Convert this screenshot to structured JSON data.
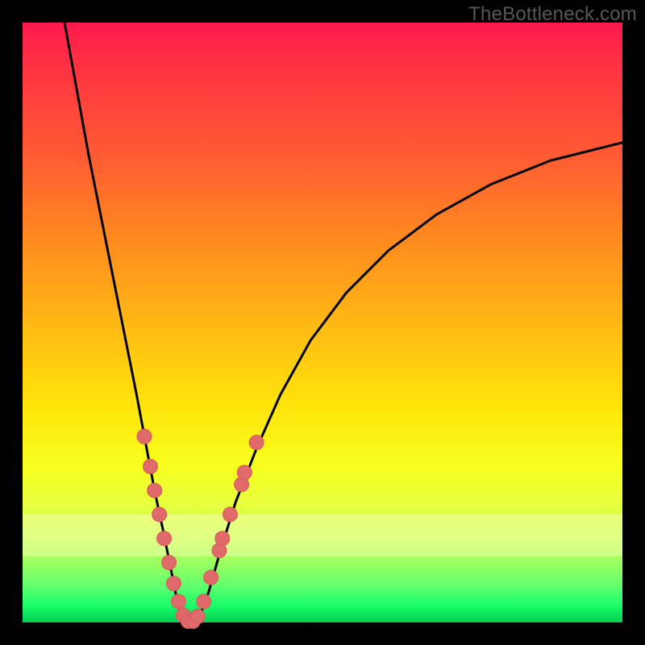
{
  "watermark": "TheBottleneck.com",
  "colors": {
    "frame": "#000000",
    "curve": "#000000",
    "marker_fill": "#e06a6a",
    "marker_stroke": "#d65a5a",
    "band": "rgba(255,255,200,0.42)"
  },
  "chart_data": {
    "type": "line",
    "title": "",
    "xlabel": "",
    "ylabel": "",
    "xlim": [
      0,
      100
    ],
    "ylim": [
      0,
      100
    ],
    "grid": false,
    "legend": false,
    "series": [
      {
        "name": "left-branch",
        "x": [
          7,
          9,
          11,
          13,
          15,
          17,
          19,
          20.5,
          22,
          23.5,
          24.7,
          25.7,
          26.5
        ],
        "y": [
          100,
          89,
          78,
          68,
          58,
          48,
          38,
          30,
          22,
          15,
          9,
          4,
          1
        ]
      },
      {
        "name": "floor",
        "x": [
          26.5,
          27.5,
          28.5,
          29.5
        ],
        "y": [
          1,
          0,
          0,
          1
        ]
      },
      {
        "name": "right-branch",
        "x": [
          29.5,
          31,
          33,
          35.5,
          39,
          43,
          48,
          54,
          61,
          69,
          78,
          88,
          100
        ],
        "y": [
          1,
          5,
          12,
          20,
          29,
          38,
          47,
          55,
          62,
          68,
          73,
          77,
          80
        ]
      }
    ],
    "markers": [
      {
        "name": "left-cluster",
        "points": [
          {
            "x": 20.3,
            "y": 31
          },
          {
            "x": 21.3,
            "y": 26
          },
          {
            "x": 22.0,
            "y": 22
          },
          {
            "x": 22.8,
            "y": 18
          },
          {
            "x": 23.6,
            "y": 14
          },
          {
            "x": 24.4,
            "y": 10
          },
          {
            "x": 25.2,
            "y": 6.5
          },
          {
            "x": 26.0,
            "y": 3.5
          }
        ]
      },
      {
        "name": "trough",
        "points": [
          {
            "x": 26.8,
            "y": 1.2
          },
          {
            "x": 27.6,
            "y": 0.2
          },
          {
            "x": 28.4,
            "y": 0.2
          },
          {
            "x": 29.2,
            "y": 1.0
          }
        ]
      },
      {
        "name": "right-cluster",
        "points": [
          {
            "x": 30.2,
            "y": 3.5
          },
          {
            "x": 31.4,
            "y": 7.5
          },
          {
            "x": 32.8,
            "y": 12
          },
          {
            "x": 33.3,
            "y": 14
          },
          {
            "x": 34.6,
            "y": 18
          },
          {
            "x": 36.5,
            "y": 23
          },
          {
            "x": 37.0,
            "y": 25
          },
          {
            "x": 39.0,
            "y": 30
          }
        ]
      }
    ]
  }
}
